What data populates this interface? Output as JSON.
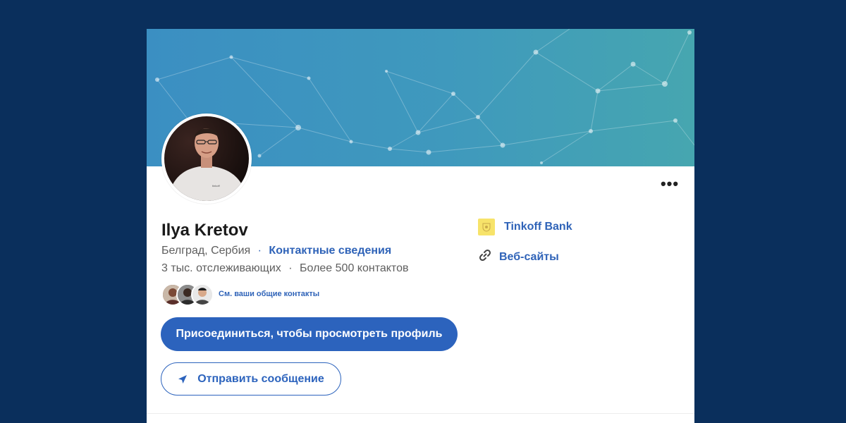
{
  "profile": {
    "name": "Ilya Kretov",
    "location": "Белград, Сербия",
    "separator": "·",
    "contact_info_label": "Контактные сведения",
    "followers": "3 тыс. отслеживающих",
    "connections": "Более 500 контактов",
    "mutual_link": "См. ваши общие контакты"
  },
  "actions": {
    "join_label": "Присоединиться, чтобы просмотреть профиль",
    "message_label": "Отправить сообщение",
    "more_label": "•••"
  },
  "sidebar": {
    "company_label": "Tinkoff Bank",
    "websites_label": "Веб-сайты"
  },
  "icons": {
    "more": "more-horizontal-icon",
    "send": "send-icon",
    "link": "link-icon",
    "company_logo": "tinkoff-logo"
  },
  "colors": {
    "page_background": "#0a2f5c",
    "primary": "#2c63bd",
    "link": "#2f63b8",
    "banner_start": "#3b8fc2",
    "banner_end": "#46a6b0",
    "company_logo_bg": "#f7e36a"
  }
}
